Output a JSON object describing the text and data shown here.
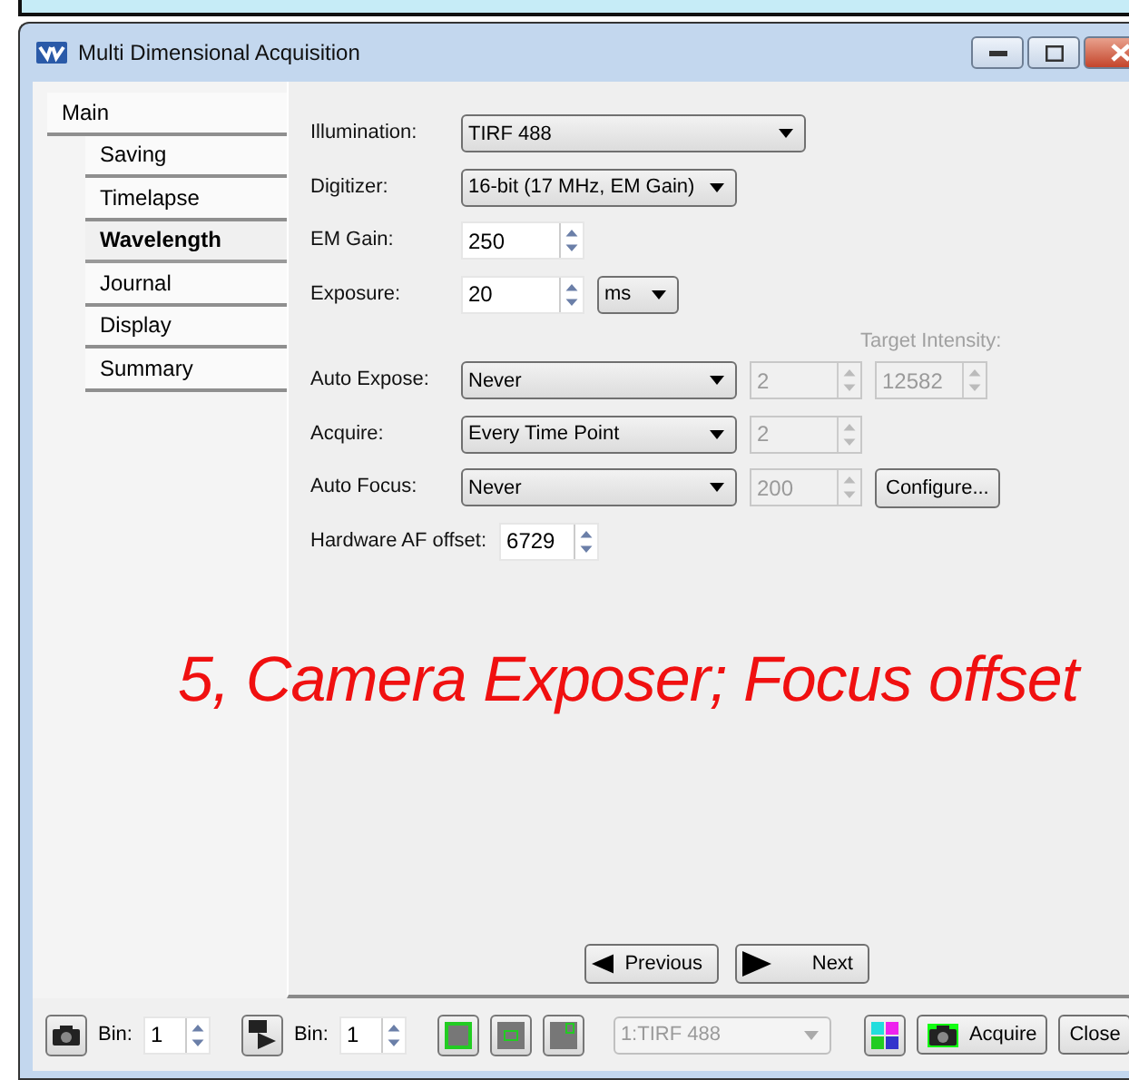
{
  "window": {
    "title": "Multi Dimensional Acquisition"
  },
  "sidebar": {
    "items": [
      {
        "label": "Main",
        "selected": false,
        "children": [
          {
            "label": "Saving",
            "selected": false
          },
          {
            "label": "Timelapse",
            "selected": false
          },
          {
            "label": "Wavelength",
            "selected": true
          },
          {
            "label": "Journal",
            "selected": false
          },
          {
            "label": "Display",
            "selected": false
          },
          {
            "label": "Summary",
            "selected": false
          }
        ]
      }
    ]
  },
  "form": {
    "rows": [
      {
        "kind": "field",
        "label": "Illumination:",
        "controls": [
          {
            "kind": "dropdown",
            "value": "TIRF 488",
            "disabled": false
          }
        ]
      },
      {
        "kind": "field",
        "label": "Digitizer:",
        "controls": [
          {
            "kind": "dropdown",
            "value": "16-bit (17 MHz, EM Gain)",
            "disabled": false
          }
        ]
      },
      {
        "kind": "field",
        "label": "EM Gain:",
        "controls": [
          {
            "kind": "spinner",
            "value": "250",
            "disabled": false
          }
        ]
      },
      {
        "kind": "field",
        "label": "Exposure:",
        "controls": [
          {
            "kind": "spinner",
            "value": "20",
            "disabled": false
          },
          {
            "kind": "dropdown",
            "value": "ms",
            "disabled": false
          }
        ]
      },
      {
        "kind": "caption",
        "label": "Target Intensity:",
        "disabled": true
      },
      {
        "kind": "field",
        "label": "Auto Expose:",
        "controls": [
          {
            "kind": "dropdown",
            "value": "Never",
            "disabled": false
          },
          {
            "kind": "spinner",
            "value": "2",
            "disabled": true
          },
          {
            "kind": "spinner",
            "value": "12582",
            "disabled": true
          }
        ]
      },
      {
        "kind": "field",
        "label": "Acquire:",
        "controls": [
          {
            "kind": "dropdown",
            "value": "Every Time Point",
            "disabled": false
          },
          {
            "kind": "spinner",
            "value": "2",
            "disabled": true
          }
        ]
      },
      {
        "kind": "field",
        "label": "Auto Focus:",
        "controls": [
          {
            "kind": "dropdown",
            "value": "Never",
            "disabled": false
          },
          {
            "kind": "spinner",
            "value": "200",
            "disabled": true
          },
          {
            "kind": "button",
            "value": "Configure..."
          }
        ]
      },
      {
        "kind": "field",
        "label": "Hardware AF offset:",
        "controls": [
          {
            "kind": "spinner",
            "value": "6729",
            "disabled": false
          }
        ]
      }
    ]
  },
  "annotation": "5, Camera Exposer; Focus offset",
  "navigation": [
    {
      "kind": "back",
      "label": "Previous"
    },
    {
      "kind": "forward",
      "label": "Next"
    }
  ],
  "toolbar": {
    "bins": [
      {
        "label": "Bin:",
        "value": "1"
      },
      {
        "label": "Bin:",
        "value": "1"
      }
    ],
    "channel": {
      "value": "1:TIRF 488",
      "disabled": true
    },
    "buttons": [
      {
        "kind": "acquire",
        "label": "Acquire"
      },
      {
        "kind": "close",
        "label": "Close"
      }
    ]
  }
}
